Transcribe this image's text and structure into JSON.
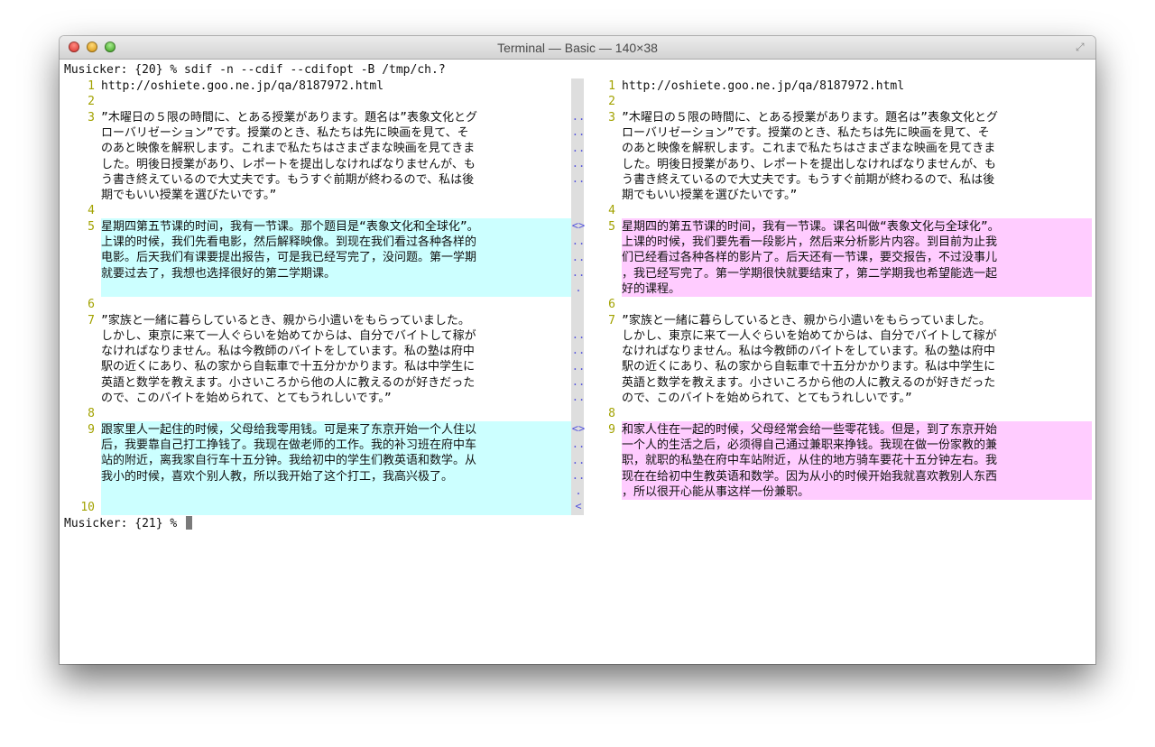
{
  "window": {
    "title": "Terminal — Basic — 140×38",
    "buttons": [
      "close",
      "minimize",
      "zoom"
    ],
    "fullscreen_icon": "fullscreen-arrows-icon"
  },
  "terminal": {
    "command_line": "Musicker: {20} % sdif -n --cdif --cdifopt -B /tmp/ch.?",
    "final_prompt": "Musicker: {21} %",
    "colors": {
      "cyan_band": "#ccffff",
      "pink_band": "#ffccff",
      "line_numbers": "#a2a200",
      "gutter": "#dedede",
      "blue_highlight": "#3333cc",
      "red_highlight": "#dd2222"
    },
    "left": [
      {
        "n": "1",
        "t": "http://oshiete.goo.ne.jp/qa/8187972.html"
      },
      {
        "n": "2",
        "t": ""
      },
      {
        "n": "3",
        "t": "”木曜日の５限の時間に、とある授業があります。題名は”表象文化とグ"
      },
      {
        "n": "",
        "t": "ローバリゼーション”です。授業のとき、私たちは先に映画を見て、そ"
      },
      {
        "n": "",
        "t": "のあと映像を解釈します。これまで私たちはさまざまな映画を見てきま"
      },
      {
        "n": "",
        "t": "した。明後日授業があり、レポートを提出しなければなりませんが、も"
      },
      {
        "n": "",
        "t": "う書き終えているので大丈夫です。もうすぐ前期が終わるので、私は後"
      },
      {
        "n": "",
        "t": "期でもいい授業を選びたいです。”"
      },
      {
        "n": "4",
        "t": ""
      },
      {
        "n": "5",
        "t": "星期四第五节课的时间，我有一节课。那个题目是“表象文化和全球化”。"
      },
      {
        "n": "",
        "t": "上课的时候，我们先看电影，然后解释映像。到现在我们看过各种各样的"
      },
      {
        "n": "",
        "t": "电影。后天我们有课要提出报告，可是我已经写完了，没问题。第一学期"
      },
      {
        "n": "",
        "t": "就要过去了，我想也选择很好的第二学期课。"
      },
      {
        "n": "",
        "t": ""
      },
      {
        "n": "6",
        "t": ""
      },
      {
        "n": "7",
        "t": "”家族と一緒に暮らしているとき、親から小遣いをもらっていました。"
      },
      {
        "n": "",
        "t": "しかし、東京に来て一人ぐらいを始めてからは、自分でバイトして稼が"
      },
      {
        "n": "",
        "t": "なければなりません。私は今教師のバイトをしています。私の塾は府中"
      },
      {
        "n": "",
        "t": "駅の近くにあり、私の家から自転車で十五分かかります。私は中学生に"
      },
      {
        "n": "",
        "t": "英語と数学を教えます。小さいころから他の人に教えるのが好きだった"
      },
      {
        "n": "",
        "t": "ので、このバイトを始められて、とてもうれしいです。”"
      },
      {
        "n": "8",
        "t": ""
      },
      {
        "n": "9",
        "t": "跟家里人一起住的时候，父母给我零用钱。可是来了东京开始一个人住以"
      },
      {
        "n": "",
        "t": "后，我要靠自己打工挣钱了。我现在做老师的工作。我的补习班在府中车"
      },
      {
        "n": "",
        "t": "站的附近，离我家自行车十五分钟。我给初中的学生们教英语和数学。从"
      },
      {
        "n": "",
        "t": "我小的时候，喜欢个别人教，所以我开始了这个打工，我高兴极了。"
      },
      {
        "n": "",
        "t": ""
      },
      {
        "n": "10",
        "t": ""
      }
    ],
    "right": [
      {
        "n": "1",
        "t": "http://oshiete.goo.ne.jp/qa/8187972.html"
      },
      {
        "n": "2",
        "t": ""
      },
      {
        "n": "3",
        "t": "”木曜日の５限の時間に、とある授業があります。題名は”表象文化とグ"
      },
      {
        "n": "",
        "t": "ローバリゼーション”です。授業のとき、私たちは先に映画を見て、そ"
      },
      {
        "n": "",
        "t": "のあと映像を解釈します。これまで私たちはさまざまな映画を見てきま"
      },
      {
        "n": "",
        "t": "した。明後日授業があり、レポートを提出しなければなりませんが、も"
      },
      {
        "n": "",
        "t": "う書き終えているので大丈夫です。もうすぐ前期が終わるので、私は後"
      },
      {
        "n": "",
        "t": "期でもいい授業を選びたいです。”"
      },
      {
        "n": "4",
        "t": ""
      },
      {
        "n": "5",
        "t": "星期四的第五节课的时间，我有一节课。课名叫做“表象文化与全球化”。"
      },
      {
        "n": "",
        "t": "上课的时候，我们要先看一段影片，然后来分析影片内容。到目前为止我"
      },
      {
        "n": "",
        "t": "们已经看过各种各样的影片了。后天还有一节课，要交报告，不过没事儿"
      },
      {
        "n": "",
        "t": "，我已经写完了。第一学期很快就要结束了，第二学期我也希望能选一起"
      },
      {
        "n": "",
        "t": "好的课程。"
      },
      {
        "n": "6",
        "t": ""
      },
      {
        "n": "7",
        "t": "”家族と一緒に暮らしているとき、親から小遣いをもらっていました。"
      },
      {
        "n": "",
        "t": "しかし、東京に来て一人ぐらいを始めてからは、自分でバイトして稼が"
      },
      {
        "n": "",
        "t": "なければなりません。私は今教師のバイトをしています。私の塾は府中"
      },
      {
        "n": "",
        "t": "駅の近くにあり、私の家から自転車で十五分かかります。私は中学生に"
      },
      {
        "n": "",
        "t": "英語と数学を教えます。小さいころから他の人に教えるのが好きだった"
      },
      {
        "n": "",
        "t": "ので、このバイトを始められて、とてもうれしいです。”"
      },
      {
        "n": "8",
        "t": ""
      },
      {
        "n": "9",
        "t": "和家人住在一起的时候，父母经常会给一些零花钱。但是，到了东京开始"
      },
      {
        "n": "",
        "t": "一个人的生活之后，必须得自己通过兼职来挣钱。我现在做一份家教的兼"
      },
      {
        "n": "",
        "t": "职，就职的私塾在府中车站附近，从住的地方骑车要花十五分钟左右。我"
      },
      {
        "n": "",
        "t": "现在在给初中生教英语和数学。因为从小的时候开始我就喜欢教别人东西"
      },
      {
        "n": "",
        "t": "，所以很开心能从事这样一份兼职。"
      }
    ],
    "gutter_marks": [
      {
        "row": 3,
        "m": ".."
      },
      {
        "row": 4,
        "m": ".."
      },
      {
        "row": 5,
        "m": ".."
      },
      {
        "row": 6,
        "m": ".."
      },
      {
        "row": 7,
        "m": ".."
      },
      {
        "row": 10,
        "m": "<>"
      },
      {
        "row": 11,
        "m": ".."
      },
      {
        "row": 12,
        "m": ".."
      },
      {
        "row": 13,
        "m": ".."
      },
      {
        "row": 14,
        "m": "."
      },
      {
        "row": 17,
        "m": ".."
      },
      {
        "row": 18,
        "m": ".."
      },
      {
        "row": 19,
        "m": ".."
      },
      {
        "row": 20,
        "m": ".."
      },
      {
        "row": 21,
        "m": ".."
      },
      {
        "row": 23,
        "m": "<>"
      },
      {
        "row": 24,
        "m": ".."
      },
      {
        "row": 25,
        "m": ".."
      },
      {
        "row": 26,
        "m": ".."
      },
      {
        "row": 27,
        "m": "."
      },
      {
        "row": 28,
        "m": "<"
      }
    ]
  }
}
